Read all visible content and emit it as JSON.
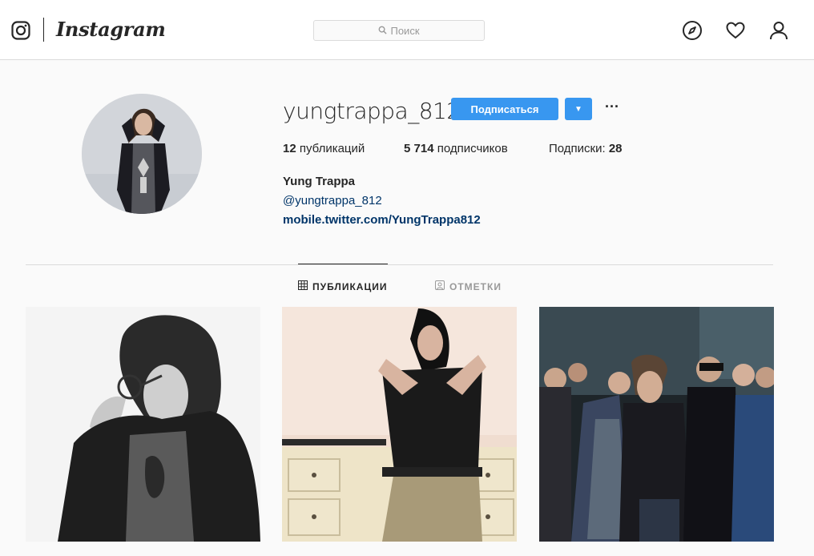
{
  "header": {
    "logo_text": "Instagram",
    "search_placeholder": "Поиск",
    "icons": [
      "instagram-glyph-icon",
      "search-icon",
      "compass-icon",
      "heart-icon",
      "user-icon"
    ]
  },
  "profile": {
    "username": "yungtrappa_812",
    "follow_label": "Подписаться",
    "stats": {
      "posts_count": "12",
      "posts_label": "публикаций",
      "followers_count": "5 714",
      "followers_label": "подписчиков",
      "following_label": "Подписки:",
      "following_count": "28"
    },
    "full_name": "Yung Trappa",
    "bio_handle": "@yungtrappa_812",
    "bio_link": "mobile.twitter.com/YungTrappa812"
  },
  "tabs": [
    {
      "label": "ПУБЛИКАЦИИ",
      "active": true,
      "icon": "grid-icon"
    },
    {
      "label": "ОТМЕТКИ",
      "active": false,
      "icon": "tagged-icon"
    }
  ],
  "colors": {
    "accent": "#3897f0",
    "link": "#003569",
    "border": "#dbdbdb",
    "background": "#fafafa"
  }
}
